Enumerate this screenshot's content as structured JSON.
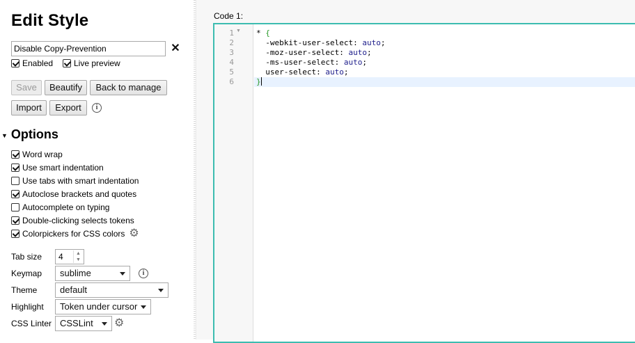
{
  "sidebar": {
    "title": "Edit Style",
    "name_value": "Disable Copy-Prevention",
    "clear_symbol": "✕",
    "enabled_label": "Enabled",
    "enabled_checked": true,
    "live_preview_label": "Live preview",
    "live_preview_checked": true,
    "buttons": {
      "save": "Save",
      "beautify": "Beautify",
      "back": "Back to manage",
      "import": "Import",
      "export": "Export"
    },
    "info_symbol": "i",
    "options_title": "Options",
    "options": [
      {
        "label": "Word wrap",
        "checked": true
      },
      {
        "label": "Use smart indentation",
        "checked": true
      },
      {
        "label": "Use tabs with smart indentation",
        "checked": false
      },
      {
        "label": "Autoclose brackets and quotes",
        "checked": true
      },
      {
        "label": "Autocomplete on typing",
        "checked": false
      },
      {
        "label": "Double-clicking selects tokens",
        "checked": true
      },
      {
        "label": "Colorpickers for CSS colors",
        "checked": true
      }
    ],
    "tab_size_label": "Tab size",
    "tab_size_value": "4",
    "keymap_label": "Keymap",
    "keymap_value": "sublime",
    "theme_label": "Theme",
    "theme_value": "default",
    "highlight_label": "Highlight",
    "highlight_value": "Token under cursor",
    "linter_label": "CSS Linter",
    "linter_value": "CSSLint"
  },
  "editor": {
    "code_label": "Code 1:",
    "line_numbers": [
      "1",
      "2",
      "3",
      "4",
      "5",
      "6"
    ],
    "lines": [
      {
        "sel": "* ",
        "brace": "{",
        "prop": "",
        "val": ""
      },
      {
        "sel": "",
        "brace": "",
        "prop": "  -webkit-user-select: ",
        "val": "auto",
        "end": ";"
      },
      {
        "sel": "",
        "brace": "",
        "prop": "  -moz-user-select: ",
        "val": "auto",
        "end": ";"
      },
      {
        "sel": "",
        "brace": "",
        "prop": "  -ms-user-select: ",
        "val": "auto",
        "end": ";"
      },
      {
        "sel": "",
        "brace": "",
        "prop": "  user-select: ",
        "val": "auto",
        "end": ";"
      },
      {
        "sel": "",
        "brace": "}",
        "prop": "",
        "val": ""
      }
    ]
  },
  "colors": {
    "editor_border": "#3cbcb0",
    "active_line": "#e8f2ff",
    "brace": "#2a9a2a",
    "value": "#1c1c8a"
  }
}
